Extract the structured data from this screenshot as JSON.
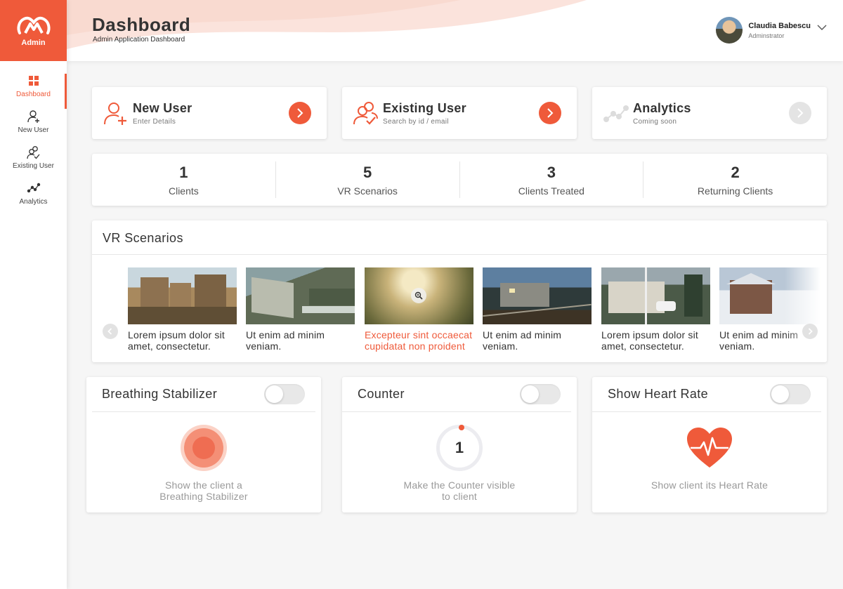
{
  "sidebar": {
    "logo_text": "Admin",
    "items": [
      {
        "label": "Dashboard",
        "icon": "grid-icon",
        "active": true
      },
      {
        "label": "New User",
        "icon": "user-add-icon"
      },
      {
        "label": "Existing User",
        "icon": "users-check-icon"
      },
      {
        "label": "Analytics",
        "icon": "analytics-icon"
      }
    ]
  },
  "header": {
    "title": "Dashboard",
    "subtitle": "Admin Application Dashboard",
    "user": {
      "name": "Claudia Babescu",
      "role": "Adminstrator"
    }
  },
  "actions": [
    {
      "title": "New User",
      "subtitle": "Enter Details",
      "icon": "user-add-icon",
      "enabled": true
    },
    {
      "title": "Existing User",
      "subtitle": "Search by id / email",
      "icon": "users-check-icon",
      "enabled": true
    },
    {
      "title": "Analytics",
      "subtitle": "Coming soon",
      "icon": "analytics-icon",
      "enabled": false
    }
  ],
  "stats": [
    {
      "value": "1",
      "label": "Clients"
    },
    {
      "value": "5",
      "label": "VR Scenarios"
    },
    {
      "value": "3",
      "label": "Clients Treated"
    },
    {
      "value": "2",
      "label": "Returning Clients"
    }
  ],
  "vr": {
    "title": "VR Scenarios",
    "items": [
      {
        "caption": "Lorem ipsum dolor sit amet, consectetur.",
        "scene": "desert-town"
      },
      {
        "caption": "Ut enim ad minim veniam.",
        "scene": "abandoned-train"
      },
      {
        "caption": "Excepteur sint occaecat cupidatat non proident",
        "scene": "misty-forest",
        "selected": true
      },
      {
        "caption": "Ut enim ad minim veniam.",
        "scene": "train-tracks"
      },
      {
        "caption": "Lorem ipsum dolor sit amet, consectetur.",
        "scene": "modern-house"
      },
      {
        "caption": "Ut enim ad minim veniam.",
        "scene": "snow-cabin"
      }
    ]
  },
  "features": [
    {
      "title": "Breathing Stabilizer",
      "desc": "Show the client a Breathing Stabilizer",
      "visual": "pulse-circle",
      "enabled": false
    },
    {
      "title": "Counter",
      "desc": "Make the Counter visible to client",
      "visual": "counter-ring",
      "counter_value": "1",
      "enabled": false
    },
    {
      "title": "Show Heart Rate",
      "desc": "Show client its Heart Rate",
      "visual": "heart-rate-icon",
      "enabled": false
    }
  ],
  "colors": {
    "accent": "#ef5a3a",
    "background": "#f6f6f6",
    "muted": "#999999"
  }
}
